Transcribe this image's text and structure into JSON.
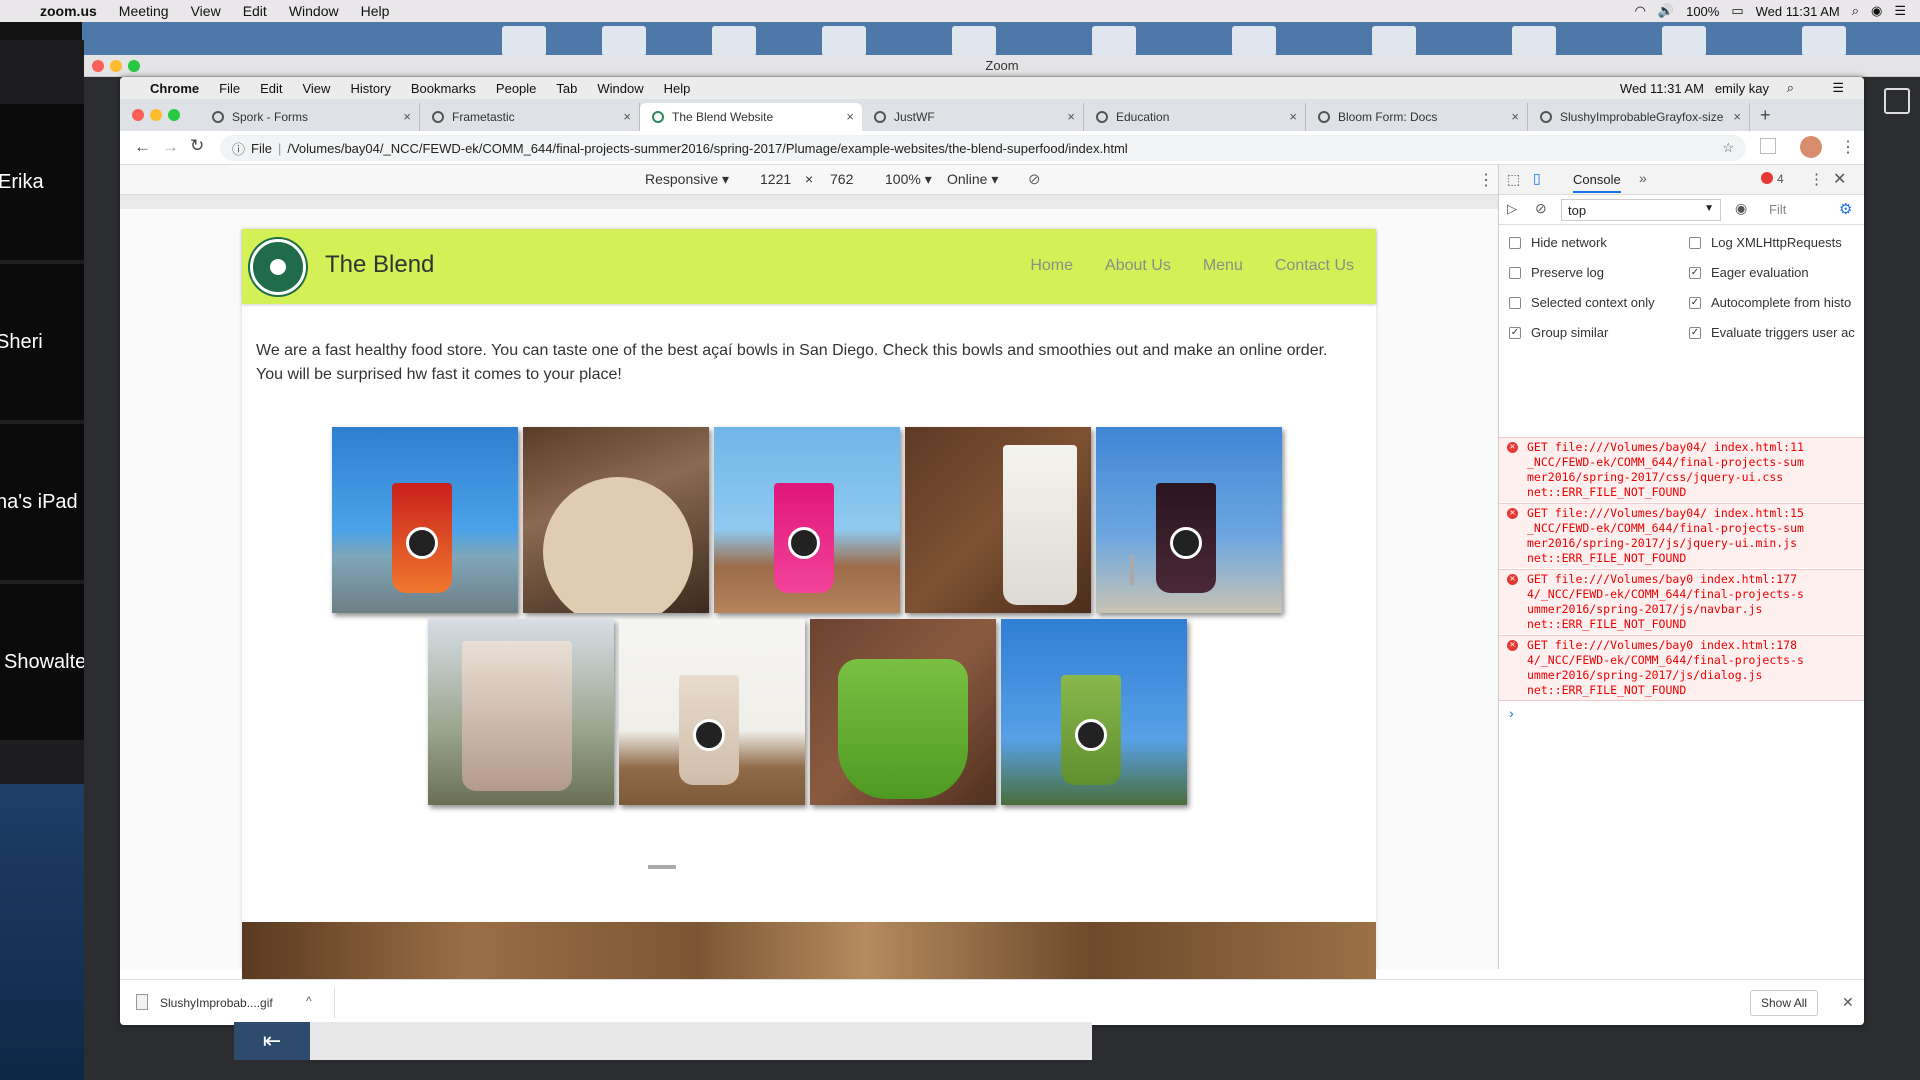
{
  "mac_menubar": {
    "items": [
      "zoom.us",
      "Meeting",
      "View",
      "Edit",
      "Window",
      "Help"
    ],
    "battery": "100%",
    "clock": "Wed 11:31 AM"
  },
  "zoom": {
    "window_title": "Zoom",
    "participants": [
      "Erika",
      "Sheri",
      "na's iPad",
      "Showalte"
    ]
  },
  "chrome_menubar": {
    "items": [
      "Chrome",
      "File",
      "Edit",
      "View",
      "History",
      "Bookmarks",
      "People",
      "Tab",
      "Window",
      "Help"
    ],
    "clock": "Wed 11:31 AM",
    "user": "emily kay"
  },
  "tabs": [
    {
      "label": "Spork - Forms",
      "close": "×"
    },
    {
      "label": "Frametastic",
      "close": "×"
    },
    {
      "label": "The Blend Website",
      "close": "×"
    },
    {
      "label": "JustWF",
      "close": "×"
    },
    {
      "label": "Education",
      "close": "×"
    },
    {
      "label": "Bloom Form: Docs",
      "close": "×"
    },
    {
      "label": "SlushyImprobableGrayfox-size",
      "close": "×"
    }
  ],
  "omnibox": {
    "scheme": "File",
    "url": "/Volumes/bay04/_NCC/FEWD-ek/COMM_644/final-projects-summer2016/spring-2017/Plumage/example-websites/the-blend-superfood/index.html"
  },
  "device_toolbar": {
    "mode": "Responsive ▾",
    "width": "1221",
    "x": "×",
    "height": "762",
    "zoom": "100% ▾",
    "network": "Online ▾"
  },
  "site": {
    "brand": "The Blend",
    "nav": [
      "Home",
      "About Us",
      "Menu",
      "Contact Us"
    ],
    "intro": "We are a fast healthy food store. You can taste one of the best açaí bowls in San Diego. Check this bowls and smoothies out and make an online order. You will be surprised hw fast it comes to your place!",
    "photo_colors": {
      "row1": [
        "#e8582a",
        "#d9c6a8",
        "#e6207d",
        "#efeee8",
        "#3a2430"
      ],
      "row2": [
        "#c9b3a4",
        "#e9ded0",
        "#5fa52d",
        "#7aa93b"
      ]
    }
  },
  "devtools": {
    "tab": "Console",
    "more": "»",
    "error_count": "4",
    "context": "top",
    "filter": "Filt",
    "options_left": [
      {
        "label": "Hide network",
        "checked": false
      },
      {
        "label": "Preserve log",
        "checked": false
      },
      {
        "label": "Selected context only",
        "checked": false
      },
      {
        "label": "Group similar",
        "checked": true
      }
    ],
    "options_right": [
      {
        "label": "Log XMLHttpRequests",
        "checked": false
      },
      {
        "label": "Eager evaluation",
        "checked": true
      },
      {
        "label": "Autocomplete from histo",
        "checked": true
      },
      {
        "label": "Evaluate triggers user ac",
        "checked": true
      }
    ],
    "errors": [
      {
        "l1": "GET file:///Volumes/bay04/ index.html:11",
        "l2": "_NCC/FEWD-ek/COMM_644/final-projects-sum",
        "l3": "mer2016/spring-2017/css/jquery-ui.css",
        "l4": "net::ERR_FILE_NOT_FOUND"
      },
      {
        "l1": "GET file:///Volumes/bay04/ index.html:15",
        "l2": "_NCC/FEWD-ek/COMM_644/final-projects-sum",
        "l3": "mer2016/spring-2017/js/jquery-ui.min.js",
        "l4": "net::ERR_FILE_NOT_FOUND"
      },
      {
        "l1": "GET file:///Volumes/bay0 index.html:177",
        "l2": "4/_NCC/FEWD-ek/COMM_644/final-projects-s",
        "l3": "ummer2016/spring-2017/js/navbar.js",
        "l4": "net::ERR_FILE_NOT_FOUND"
      },
      {
        "l1": "GET file:///Volumes/bay0 index.html:178",
        "l2": "4/_NCC/FEWD-ek/COMM_644/final-projects-s",
        "l3": "ummer2016/spring-2017/js/dialog.js",
        "l4": "net::ERR_FILE_NOT_FOUND"
      }
    ],
    "prompt": "›"
  },
  "download_bar": {
    "file": "SlushyImprobab....gif",
    "show_all": "Show All"
  }
}
